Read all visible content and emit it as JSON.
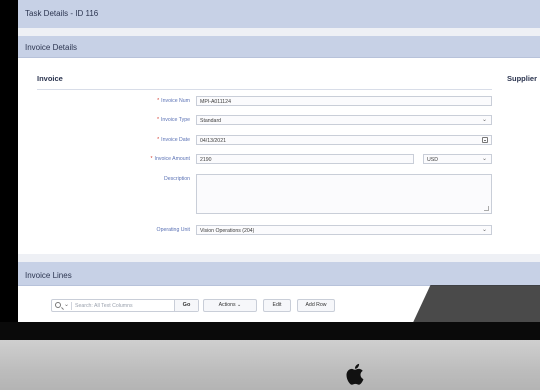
{
  "task": {
    "title": "Task Details - ID 116"
  },
  "invoice_details": {
    "title": "Invoice Details"
  },
  "invoice_section": {
    "title": "Invoice",
    "supplier_title": "Supplier"
  },
  "form": {
    "invoice_num": {
      "label": "Invoice Num",
      "value": "MPI-A011124",
      "required": true
    },
    "invoice_type": {
      "label": "Invoice Type",
      "value": "Standard",
      "required": true
    },
    "invoice_date": {
      "label": "Invoice Date",
      "value": "04/13/2021",
      "required": true
    },
    "invoice_amount": {
      "label": "Invoice Amount",
      "value": "2190",
      "currency": "USD",
      "required": true
    },
    "description": {
      "label": "Description",
      "value": ""
    },
    "operating_unit": {
      "label": "Operating Unit",
      "value": "Vision Operations (204)"
    }
  },
  "invoice_lines": {
    "title": "Invoice Lines",
    "search_placeholder": "Search: All Text Columns",
    "go_label": "Go",
    "actions_label": "Actions",
    "edit_label": "Edit",
    "add_row_label": "Add Row"
  },
  "icons": {
    "chevron": "chevron-down-icon",
    "calendar": "calendar-icon",
    "search": "search-icon",
    "apple": "apple-logo"
  },
  "colors": {
    "header_band": "#c7d1e6",
    "label_blue": "#5b72b5",
    "required_red": "#d13b2f",
    "page_bg": "#eef0f5"
  }
}
